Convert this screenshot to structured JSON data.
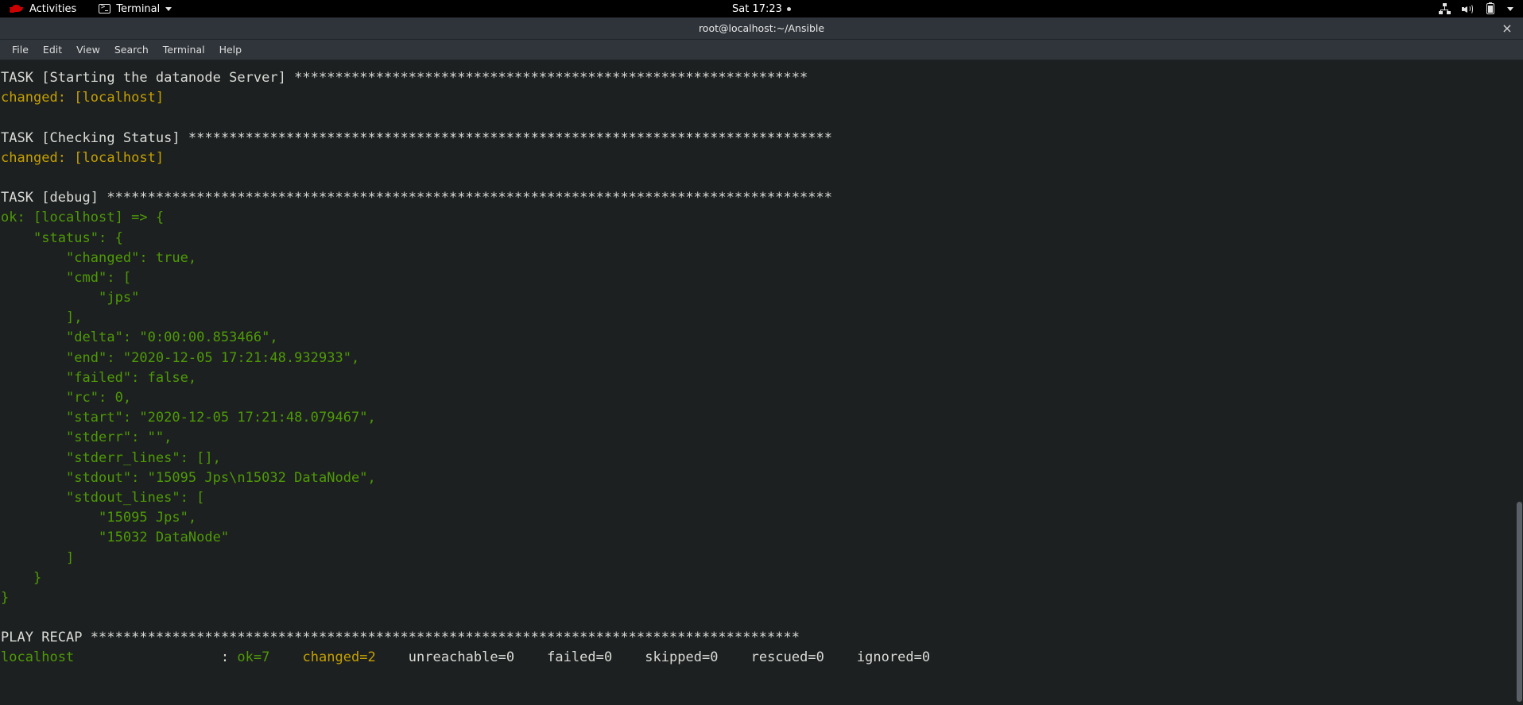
{
  "topbar": {
    "logo_icon": "redhat-logo-icon",
    "activities_label": "Activities",
    "app_name": "Terminal",
    "app_icon": "terminal-icon",
    "app_caret_icon": "chevron-down-icon",
    "clock": "Sat 17:23",
    "clock_indicator_icon": "notification-dot-icon",
    "tray": {
      "network_icon": "network-wired-icon",
      "volume_icon": "volume-high-icon",
      "battery_icon": "battery-icon",
      "menu_icon": "chevron-down-icon"
    }
  },
  "window": {
    "title": "root@localhost:~/Ansible",
    "close_icon": "close-icon",
    "close_label": "×",
    "menus": [
      "File",
      "Edit",
      "View",
      "Search",
      "Terminal",
      "Help"
    ]
  },
  "colors": {
    "background": "#1d2021",
    "foreground": "#d9dbd6",
    "green": "#4e9a06",
    "yellow": "#c4a000",
    "titlebar": "#2f343a",
    "topbar": "#000000",
    "brand_red": "#cc0000"
  },
  "terminal": {
    "lines": [
      {
        "text": "TASK [Starting the datanode Server] ***************************************************************",
        "color": "white"
      },
      {
        "text": "changed: [localhost]",
        "color": "yellow"
      },
      {
        "text": "",
        "color": "white"
      },
      {
        "text": "TASK [Checking Status] *******************************************************************************",
        "color": "white"
      },
      {
        "text": "changed: [localhost]",
        "color": "yellow"
      },
      {
        "text": "",
        "color": "white"
      },
      {
        "text": "TASK [debug] *****************************************************************************************",
        "color": "white"
      },
      {
        "text": "ok: [localhost] => {",
        "color": "green"
      },
      {
        "text": "    \"status\": {",
        "color": "green"
      },
      {
        "text": "        \"changed\": true,",
        "color": "green"
      },
      {
        "text": "        \"cmd\": [",
        "color": "green"
      },
      {
        "text": "            \"jps\"",
        "color": "green"
      },
      {
        "text": "        ],",
        "color": "green"
      },
      {
        "text": "        \"delta\": \"0:00:00.853466\",",
        "color": "green"
      },
      {
        "text": "        \"end\": \"2020-12-05 17:21:48.932933\",",
        "color": "green"
      },
      {
        "text": "        \"failed\": false,",
        "color": "green"
      },
      {
        "text": "        \"rc\": 0,",
        "color": "green"
      },
      {
        "text": "        \"start\": \"2020-12-05 17:21:48.079467\",",
        "color": "green"
      },
      {
        "text": "        \"stderr\": \"\",",
        "color": "green"
      },
      {
        "text": "        \"stderr_lines\": [],",
        "color": "green"
      },
      {
        "text": "        \"stdout\": \"15095 Jps\\n15032 DataNode\",",
        "color": "green"
      },
      {
        "text": "        \"stdout_lines\": [",
        "color": "green"
      },
      {
        "text": "            \"15095 Jps\",",
        "color": "green"
      },
      {
        "text": "            \"15032 DataNode\"",
        "color": "green"
      },
      {
        "text": "        ]",
        "color": "green"
      },
      {
        "text": "    }",
        "color": "green"
      },
      {
        "text": "}",
        "color": "green"
      },
      {
        "text": "",
        "color": "white"
      },
      {
        "text": "PLAY RECAP ***************************************************************************************",
        "color": "white"
      }
    ],
    "recap": {
      "host": "localhost",
      "spacer": "                  : ",
      "ok": "ok=7",
      "gap1": "    ",
      "changed": "changed=2",
      "gap2": "    ",
      "unreachable": "unreachable=0",
      "gap3": "    ",
      "failed": "failed=0",
      "gap4": "    ",
      "skipped": "skipped=0",
      "gap5": "    ",
      "rescued": "rescued=0",
      "gap6": "    ",
      "ignored": "ignored=0"
    },
    "scrollbar_name": "vertical-scrollbar"
  }
}
